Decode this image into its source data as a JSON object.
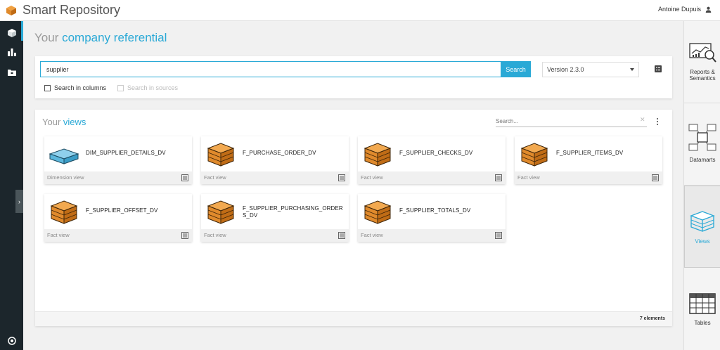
{
  "app": {
    "title": "Smart Repository",
    "user_name": "Antoine Dupuis"
  },
  "page": {
    "title_prefix": "Your ",
    "title_accent": "company referential"
  },
  "search": {
    "value": "supplier",
    "button_label": "Search",
    "version": "Version 2.3.0",
    "search_in_columns": "Search in columns",
    "search_in_sources": "Search in sources"
  },
  "views": {
    "title_prefix": "Your ",
    "title_accent": "views",
    "search_placeholder": "Search...",
    "count_label": "7 elements",
    "cards": [
      {
        "name": "DIM_SUPPLIER_DETAILS_DV",
        "type": "Dimension view",
        "icon": "dimension-cube-icon"
      },
      {
        "name": "F_PURCHASE_ORDER_DV",
        "type": "Fact view",
        "icon": "fact-cube-icon"
      },
      {
        "name": "F_SUPPLIER_CHECKS_DV",
        "type": "Fact view",
        "icon": "fact-cube-icon"
      },
      {
        "name": "F_SUPPLIER_ITEMS_DV",
        "type": "Fact view",
        "icon": "fact-cube-icon"
      },
      {
        "name": "F_SUPPLIER_OFFSET_DV",
        "type": "Fact view",
        "icon": "fact-cube-icon"
      },
      {
        "name": "F_SUPPLIER_PURCHASING_ORDERS_DV",
        "type": "Fact view",
        "icon": "fact-cube-icon"
      },
      {
        "name": "F_SUPPLIER_TOTALS_DV",
        "type": "Fact view",
        "icon": "fact-cube-icon"
      }
    ]
  },
  "right_nav": [
    {
      "label": "Reports & Semantics",
      "icon": "reports-icon"
    },
    {
      "label": "Datamarts",
      "icon": "datamarts-icon"
    },
    {
      "label": "Views",
      "icon": "views-icon"
    },
    {
      "label": "Tables",
      "icon": "tables-icon"
    }
  ],
  "colors": {
    "accent": "#2aa9d6",
    "fact_orange": "#e08a2c",
    "dimension_blue": "#5bb7dd",
    "sidebar": "#1c262c"
  }
}
